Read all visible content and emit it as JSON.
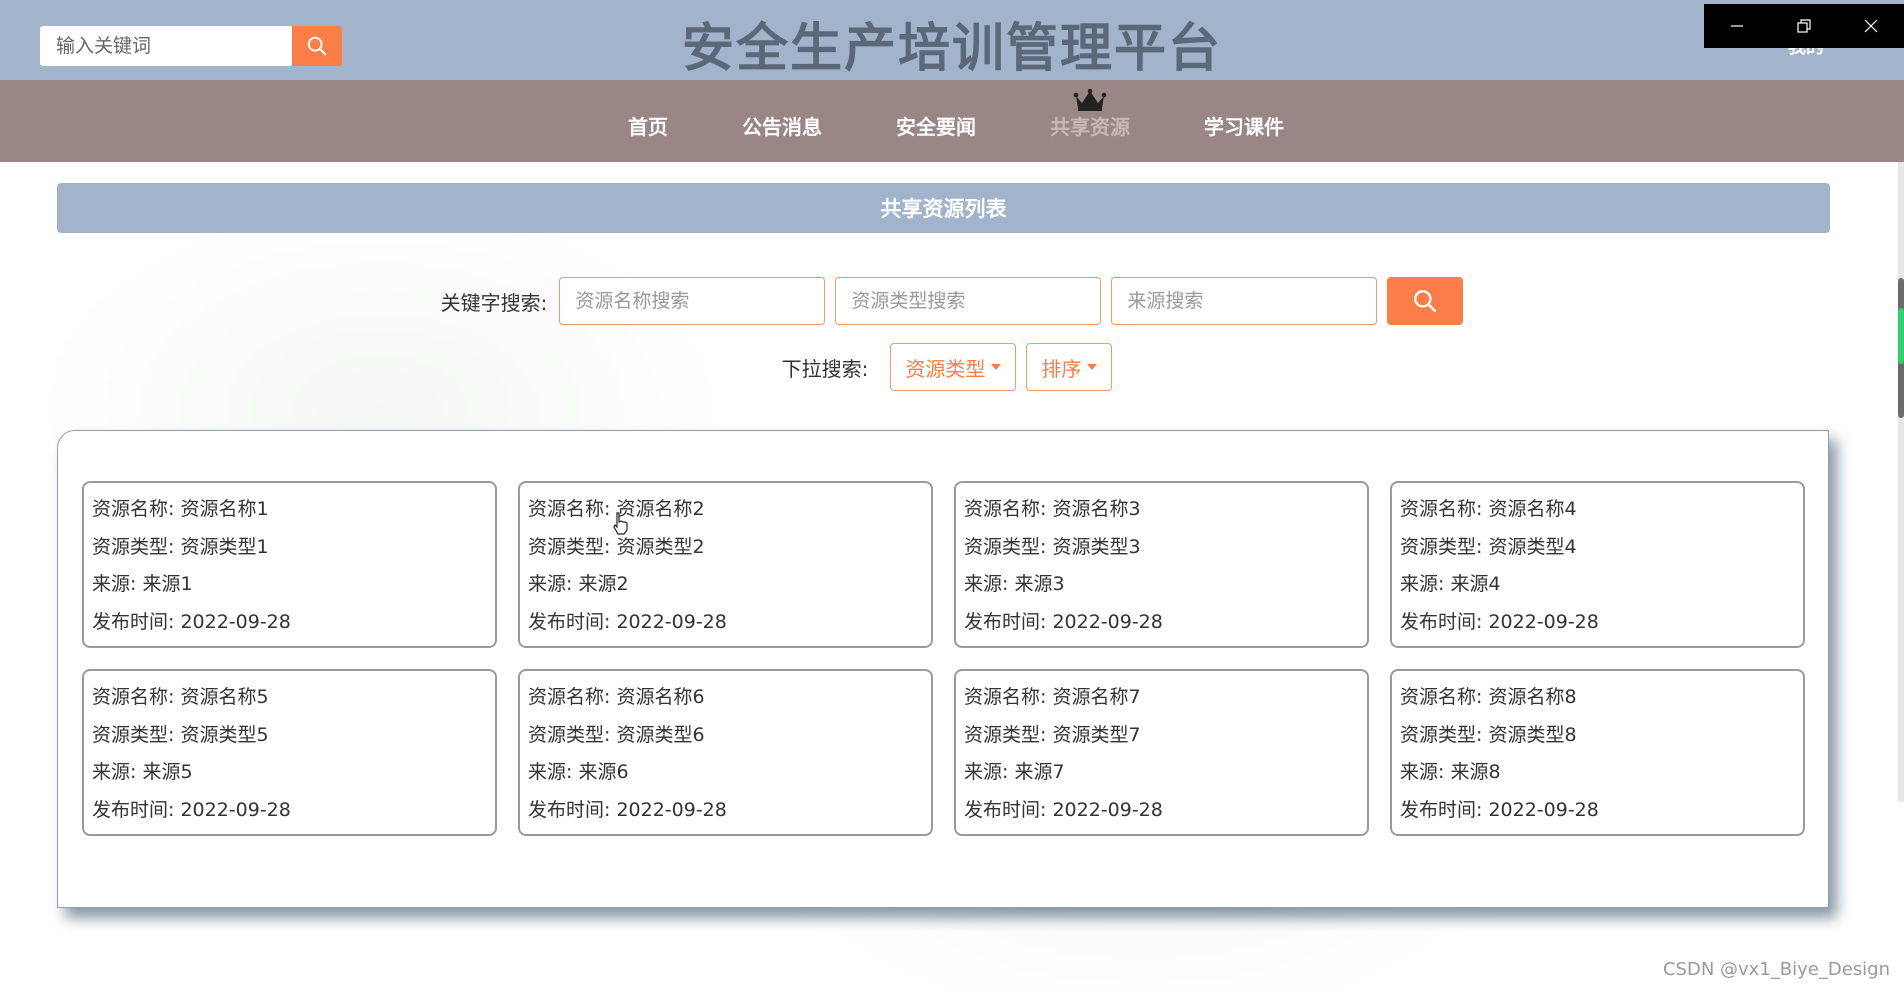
{
  "header": {
    "search_placeholder": "输入关键词",
    "site_title": "安全生产培训管理平台",
    "user_label": "我的"
  },
  "nav": {
    "items": [
      {
        "label": "首页",
        "active": false
      },
      {
        "label": "公告消息",
        "active": false
      },
      {
        "label": "安全要闻",
        "active": false
      },
      {
        "label": "共享资源",
        "active": true
      },
      {
        "label": "学习课件",
        "active": false
      }
    ]
  },
  "section": {
    "title": "共享资源列表"
  },
  "search": {
    "keyword_label": "关键字搜索:",
    "name_placeholder": "资源名称搜索",
    "type_placeholder": "资源类型搜索",
    "source_placeholder": "来源搜索",
    "dropdown_label": "下拉搜索:",
    "type_dropdown": "资源类型",
    "sort_dropdown": "排序"
  },
  "resources": [
    {
      "name": "资源名称: 资源名称1",
      "type": "资源类型: 资源类型1",
      "source": "来源: 来源1",
      "date": "发布时间: 2022-09-28"
    },
    {
      "name": "资源名称: 资源名称2",
      "type": "资源类型: 资源类型2",
      "source": "来源: 来源2",
      "date": "发布时间: 2022-09-28"
    },
    {
      "name": "资源名称: 资源名称3",
      "type": "资源类型: 资源类型3",
      "source": "来源: 来源3",
      "date": "发布时间: 2022-09-28"
    },
    {
      "name": "资源名称: 资源名称4",
      "type": "资源类型: 资源类型4",
      "source": "来源: 来源4",
      "date": "发布时间: 2022-09-28"
    },
    {
      "name": "资源名称: 资源名称5",
      "type": "资源类型: 资源类型5",
      "source": "来源: 来源5",
      "date": "发布时间: 2022-09-28"
    },
    {
      "name": "资源名称: 资源名称6",
      "type": "资源类型: 资源类型6",
      "source": "来源: 来源6",
      "date": "发布时间: 2022-09-28"
    },
    {
      "name": "资源名称: 资源名称7",
      "type": "资源类型: 资源类型7",
      "source": "来源: 来源7",
      "date": "发布时间: 2022-09-28"
    },
    {
      "name": "资源名称: 资源名称8",
      "type": "资源类型: 资源类型8",
      "source": "来源: 来源8",
      "date": "发布时间: 2022-09-28"
    }
  ],
  "watermark": "CSDN @vx1_Biye_Design",
  "colors": {
    "header_bg": "#a2b3cc",
    "nav_bg": "#9a8684",
    "accent": "#fb7d47",
    "title_text": "#5b6878"
  },
  "icons": {
    "search": "search-icon",
    "crown": "crown-icon",
    "minimize": "minimize-icon",
    "restore": "restore-icon",
    "close": "close-icon",
    "caret": "caret-down-icon"
  }
}
